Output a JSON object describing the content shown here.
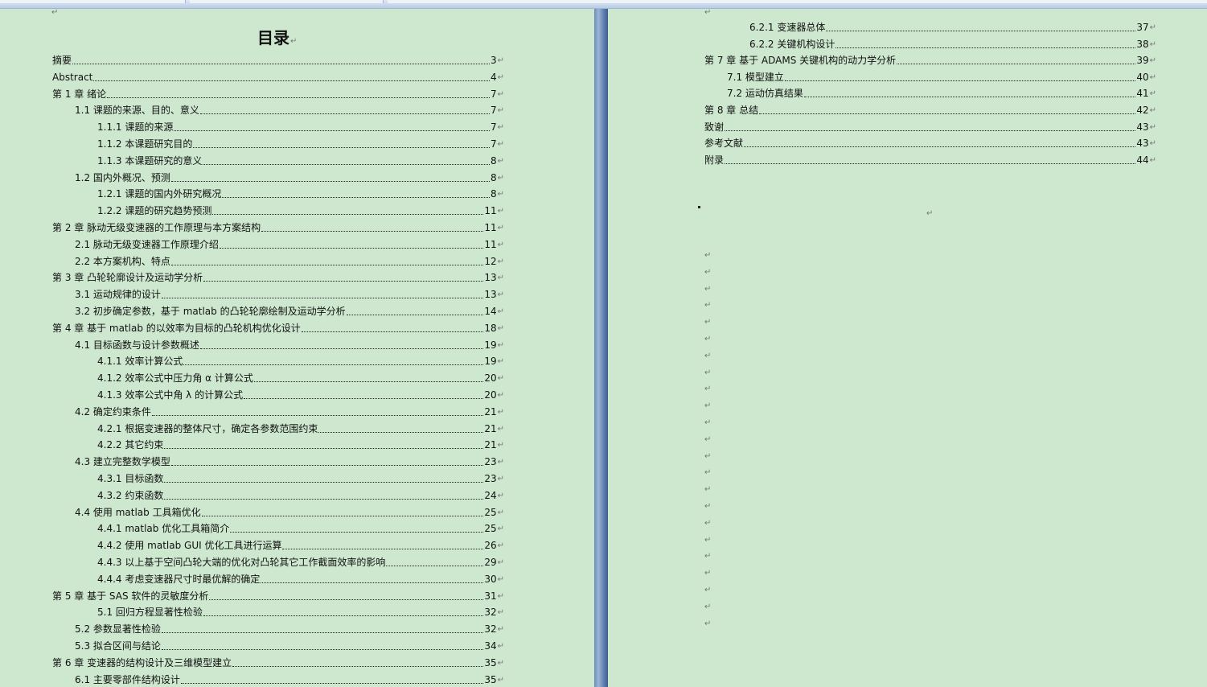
{
  "paragraph_mark": "↵",
  "toc_title": "目录",
  "left_entries": [
    {
      "label": "摘要",
      "page": "3",
      "level": 0
    },
    {
      "label": "Abstract",
      "page": "4",
      "level": 0
    },
    {
      "label": "第 1 章  绪论",
      "page": "7",
      "level": 0
    },
    {
      "label": "1.1 课题的来源、目的、意义",
      "page": "7",
      "level": 1
    },
    {
      "label": "1.1.1 课题的来源",
      "page": "7",
      "level": 2
    },
    {
      "label": "1.1.2 本课题研究目的",
      "page": "7",
      "level": 2
    },
    {
      "label": "1.1.3 本课题研究的意义",
      "page": "8",
      "level": 2
    },
    {
      "label": "1.2 国内外概况、预测",
      "page": "8",
      "level": 1
    },
    {
      "label": "1.2.1 课题的国内外研究概况",
      "page": "8",
      "level": 2
    },
    {
      "label": "1.2.2 课题的研究趋势预测",
      "page": "11",
      "level": 2
    },
    {
      "label": "第 2 章   脉动无级变速器的工作原理与本方案结构",
      "page": "11",
      "level": 0
    },
    {
      "label": "2.1  脉动无级变速器工作原理介绍",
      "page": "11",
      "level": 1
    },
    {
      "label": "2.2  本方案机构、特点",
      "page": "12",
      "level": 1
    },
    {
      "label": "第 3 章  凸轮轮廓设计及运动学分析",
      "page": "13",
      "level": 0
    },
    {
      "label": "3.1 运动规律的设计",
      "page": "13",
      "level": 1
    },
    {
      "label": "3.2  初步确定参数，基于 matlab 的凸轮轮廓绘制及运动学分析",
      "page": "14",
      "level": 1
    },
    {
      "label": "第 4 章  基于 matlab 的以效率为目标的凸轮机构优化设计",
      "page": "18",
      "level": 0
    },
    {
      "label": "4.1  目标函数与设计参数概述",
      "page": "19",
      "level": 1
    },
    {
      "label": "4.1.1  效率计算公式",
      "page": "19",
      "level": 2
    },
    {
      "label": "4.1.2  效率公式中压力角 α 计算公式",
      "page": "20",
      "level": 2
    },
    {
      "label": "4.1.3 效率公式中角 λ 的计算公式",
      "page": "20",
      "level": 2
    },
    {
      "label": "4.2 确定约束条件",
      "page": "21",
      "level": 1
    },
    {
      "label": "4.2.1 根据变速器的整体尺寸，确定各参数范围约束",
      "page": "21",
      "level": 2
    },
    {
      "label": "4.2.2 其它约束",
      "page": "21",
      "level": 2
    },
    {
      "label": "4.3 建立完整数学模型",
      "page": "23",
      "level": 1
    },
    {
      "label": "4.3.1 目标函数",
      "page": "23",
      "level": 2
    },
    {
      "label": "4.3.2 约束函数",
      "page": "24",
      "level": 2
    },
    {
      "label": "4.4  使用 matlab 工具箱优化",
      "page": "25",
      "level": 1
    },
    {
      "label": "4.4.1  matlab 优化工具箱简介",
      "page": "25",
      "level": 2
    },
    {
      "label": "4.4.2  使用 matlab GUI  优化工具进行运算",
      "page": "26",
      "level": 2
    },
    {
      "label": "4.4.3  以上基于空间凸轮大端的优化对凸轮其它工作截面效率的影响",
      "page": "29",
      "level": 2
    },
    {
      "label": "4.4.4  考虑变速器尺寸时最优解的确定",
      "page": "30",
      "level": 2
    },
    {
      "label": "第 5 章  基于 SAS 软件的灵敏度分析",
      "page": "31",
      "level": 0
    },
    {
      "label": "5.1  回归方程显著性检验",
      "page": "32",
      "level": 2
    },
    {
      "label": "5.2  参数显著性检验",
      "page": "32",
      "level": 1
    },
    {
      "label": "5.3  拟合区间与结论",
      "page": "34",
      "level": 1
    },
    {
      "label": "第 6 章  变速器的结构设计及三维模型建立",
      "page": "35",
      "level": 0
    },
    {
      "label": "6.1  主要零部件结构设计",
      "page": "35",
      "level": 1
    }
  ],
  "right_entries": [
    {
      "label": "6.2.1  变速器总体",
      "page": "37",
      "level": 2
    },
    {
      "label": "6.2.2  关键机构设计",
      "page": "38",
      "level": 2
    },
    {
      "label": "第 7 章  基于 ADAMS 关键机构的动力学分析",
      "page": "39",
      "level": 0
    },
    {
      "label": "7.1  模型建立",
      "page": "40",
      "level": 1
    },
    {
      "label": "7.2  运动仿真结果",
      "page": "41",
      "level": 1
    },
    {
      "label": "第 8 章  总结",
      "page": "42",
      "level": 0
    },
    {
      "label": "致谢",
      "page": "43",
      "level": 0
    },
    {
      "label": "参考文献",
      "page": "43",
      "level": 0
    },
    {
      "label": "附录",
      "page": "44",
      "level": 0
    }
  ],
  "empty_paragraph_count": 23
}
